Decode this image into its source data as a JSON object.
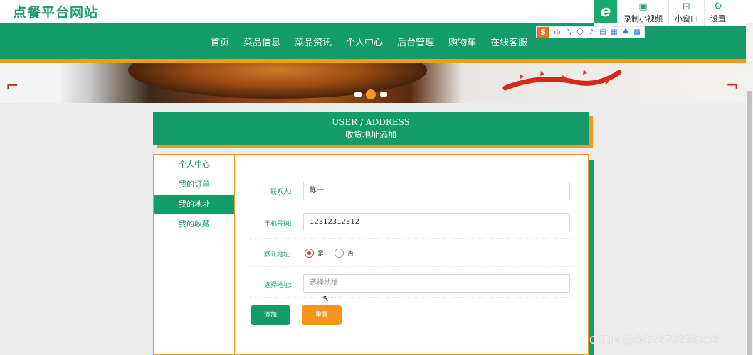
{
  "site": {
    "title": "点餐平台网站"
  },
  "nav": {
    "items": [
      "首页",
      "菜品信息",
      "菜品资讯",
      "个人中心",
      "后台管理",
      "购物车",
      "在线客服"
    ]
  },
  "toolbar": {
    "record_label": "录制小视频",
    "mini_window_label": "小窗口",
    "settings_label": "设置"
  },
  "ime": {
    "lang": "中"
  },
  "section": {
    "title_en": "USER / ADDRESS",
    "title_zh": "收货地址添加"
  },
  "sidebar": {
    "items": [
      "个人中心",
      "我的订单",
      "我的地址",
      "我的收藏"
    ],
    "active_index": 2
  },
  "form": {
    "contact_label": "联系人:",
    "contact_value": "陈一",
    "phone_label": "手机号码:",
    "phone_value": "12312312312",
    "default_label": "默认地址:",
    "default_options": [
      "是",
      "否"
    ],
    "default_selected": "是",
    "address_label": "选择地址:",
    "address_placeholder": "选择地址",
    "add_button": "添加",
    "reset_button": "重置"
  },
  "watermark": "CSDN @QQ2279239102",
  "colors": {
    "primary": "#139b6a",
    "accent": "#f39a1e"
  }
}
